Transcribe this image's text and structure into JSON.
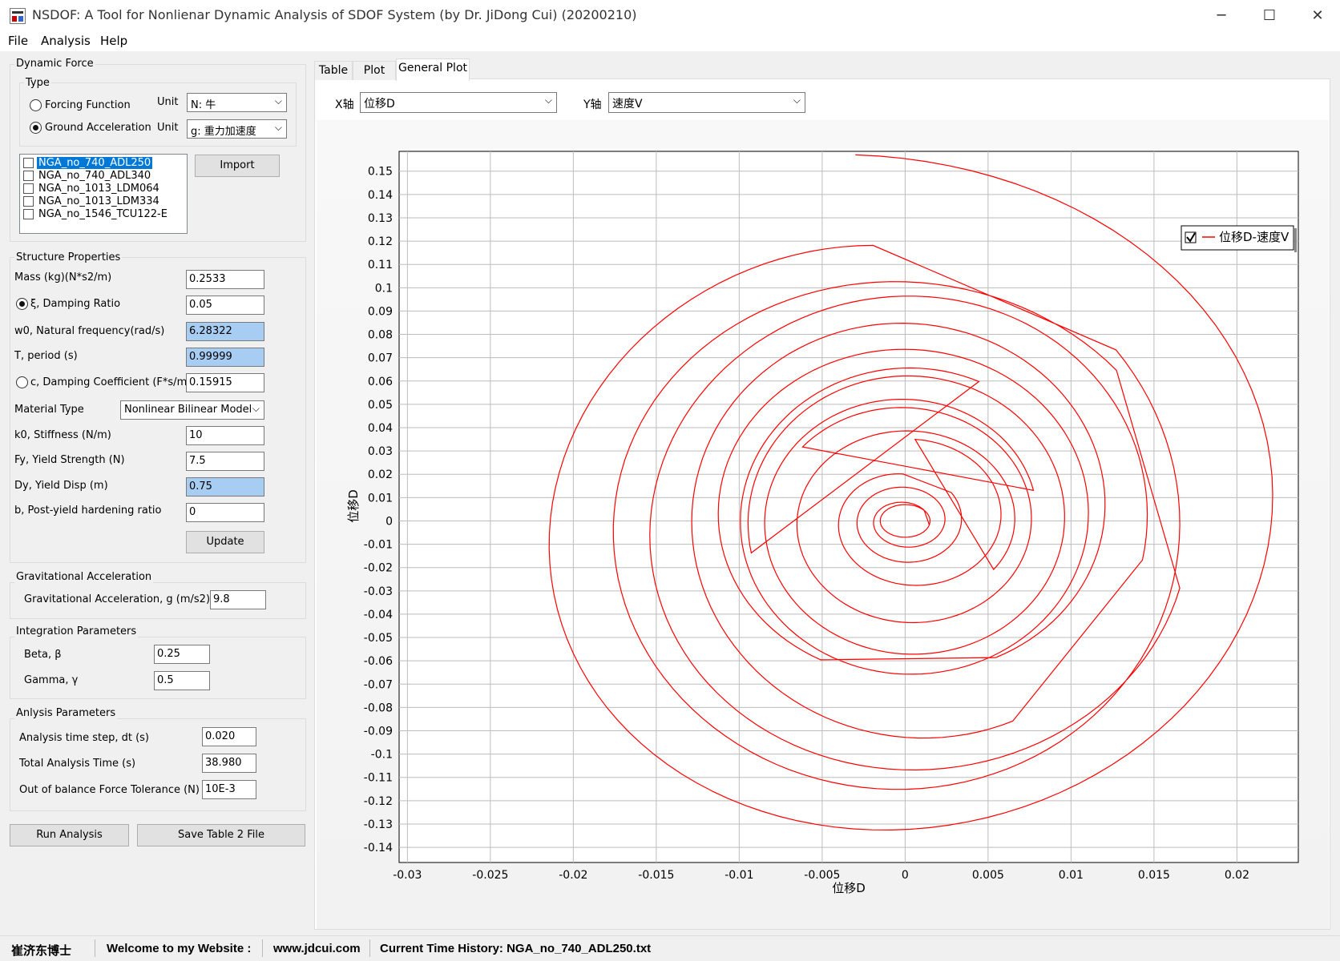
{
  "window": {
    "title": "NSDOF: A Tool for Nonlienar Dynamic Analysis of SDOF System (by Dr. JiDong Cui) (20200210)",
    "minimize": "─",
    "maximize": "☐",
    "close": "✕"
  },
  "menu": [
    "File",
    "Analysis",
    "Help"
  ],
  "dynamic_force": {
    "title": "Dynamic Force",
    "type_title": "Type",
    "forcing_label": "Forcing Function",
    "forcing_unit_label": "Unit",
    "forcing_unit": "N: 牛",
    "ground_label": "Ground Acceleration",
    "ground_unit_label": "Unit",
    "ground_unit": "g: 重力加速度",
    "selected": "ground",
    "records": [
      "NGA_no_740_ADL250",
      "NGA_no_740_ADL340",
      "NGA_no_1013_LDM064",
      "NGA_no_1013_LDM334",
      "NGA_no_1546_TCU122-E"
    ],
    "import_label": "Import"
  },
  "structure": {
    "title": "Structure Properties",
    "mass_label": "Mass (kg)(N*s2/m)",
    "mass": "0.2533",
    "xi_label": "ξ, Damping Ratio",
    "xi": "0.05",
    "w0_label": "w0, Natural frequency(rad/s)",
    "w0": "6.28322",
    "t_label": "T, period (s)",
    "t": "0.99999",
    "c_label": "c, Damping Coefficient (F*s/m)",
    "c": "0.15915",
    "material_label": "Material Type",
    "material": "Nonlinear Bilinear Model",
    "k0_label": "k0, Stiffness (N/m)",
    "k0": "10",
    "fy_label": "Fy, Yield Strength (N)",
    "fy": "7.5",
    "dy_label": "Dy, Yield Disp (m)",
    "dy": "0.75",
    "b_label": "b, Post-yield hardening ratio",
    "b": "0",
    "update_label": "Update"
  },
  "gravity": {
    "title": "Gravitational Acceleration",
    "g_label": "Gravitational Acceleration, g (m/s2)",
    "g": "9.8"
  },
  "integration": {
    "title": "Integration Parameters",
    "beta_label": "Beta, β",
    "beta": "0.25",
    "gamma_label": "Gamma, γ",
    "gamma": "0.5"
  },
  "analysis": {
    "title": "Anlysis  Parameters",
    "dt_label": "Analysis time step, dt (s)",
    "dt": "0.020",
    "total_label": "Total Analysis Time (s)",
    "total": "38.980",
    "tol_label": "Out of balance Force Tolerance (N)",
    "tol": "10E-3"
  },
  "buttons": {
    "run": "Run Analysis",
    "save": "Save Table 2 File"
  },
  "tabs": [
    "Table",
    "Plot",
    "General Plot"
  ],
  "active_tab": "General Plot",
  "axis_select": {
    "x_label": "X轴",
    "x_value": "位移D",
    "y_label": "Y轴",
    "y_value": "速度V"
  },
  "chart_data": {
    "type": "line",
    "title": "",
    "xlabel": "位移D",
    "ylabel": "位移D",
    "xlim": [
      -0.0305,
      0.0237
    ],
    "ylim": [
      -0.1465,
      0.1585
    ],
    "x_ticks": [
      -0.03,
      -0.025,
      -0.02,
      -0.015,
      -0.01,
      -0.005,
      0,
      0.005,
      0.01,
      0.015,
      0.02
    ],
    "x_tick_labels": [
      "-0.03",
      "-0.025",
      "-0.02",
      "-0.015",
      "-0.01",
      "-0.005",
      "0",
      "0.005",
      "0.01",
      "0.015",
      "0.02"
    ],
    "y_ticks": [
      0.15,
      0.14,
      0.13,
      0.12,
      0.11,
      0.1,
      0.09,
      0.08,
      0.07,
      0.06,
      0.05,
      0.04,
      0.03,
      0.02,
      0.01,
      0,
      -0.01,
      -0.02,
      -0.03,
      -0.04,
      -0.05,
      -0.06,
      -0.07,
      -0.08,
      -0.09,
      -0.1,
      -0.11,
      -0.12,
      -0.13,
      -0.14
    ],
    "y_tick_labels": [
      "0.15",
      "0.14",
      "0.13",
      "0.12",
      "0.11",
      "0.1",
      "0.09",
      "0.08",
      "0.07",
      "0.06",
      "0.05",
      "0.04",
      "0.03",
      "0.02",
      "0.01",
      "0",
      "-0.01",
      "-0.02",
      "-0.03",
      "-0.04",
      "-0.05",
      "-0.06",
      "-0.07",
      "-0.08",
      "-0.09",
      "-0.1",
      "-0.11",
      "-0.12",
      "-0.13",
      "-0.14"
    ],
    "grid": true,
    "legend_position": "top-right",
    "series": [
      {
        "name": "位移D-速度V",
        "color": "#ff0000",
        "spiral_segments": [
          {
            "cx": -0.003,
            "cy": 0.005,
            "ax": 0.027,
            "ay": 0.152,
            "turns": 1.0
          },
          {
            "cx": -0.001,
            "cy": 0.0,
            "ax": 0.0175,
            "ay": 0.118,
            "turns": 1.0
          },
          {
            "cx": 0.0,
            "cy": -0.005,
            "ax": 0.017,
            "ay": 0.105,
            "turns": 1.0
          },
          {
            "cx": 0.0005,
            "cy": 0.0,
            "ax": 0.014,
            "ay": 0.095,
            "turns": 1.0
          },
          {
            "cx": 0.0,
            "cy": 0.005,
            "ax": 0.0115,
            "ay": 0.072,
            "turns": 1.5
          },
          {
            "cx": 0.0005,
            "cy": 0.0,
            "ax": 0.01,
            "ay": 0.065,
            "turns": 1.5
          },
          {
            "cx": 0.0,
            "cy": 0.0,
            "ax": 0.008,
            "ay": 0.05,
            "turns": 1.5
          },
          {
            "cx": 0.0005,
            "cy": 0.0,
            "ax": 0.006,
            "ay": 0.035,
            "turns": 1.0
          },
          {
            "cx": 0.0,
            "cy": 0.0,
            "ax": 0.0035,
            "ay": 0.02,
            "turns": 2.0
          },
          {
            "cx": 0.0,
            "cy": 0.0,
            "ax": 0.0015,
            "ay": 0.007,
            "turns": 3.0
          }
        ]
      }
    ]
  },
  "status": {
    "name": "崔济东博士",
    "welcome": "Welcome to my Website :",
    "site": "www.jdcui.com",
    "history": "Current Time History: NGA_no_740_ADL250.txt"
  }
}
